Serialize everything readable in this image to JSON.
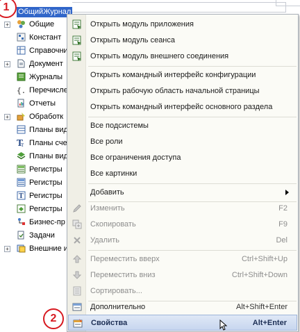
{
  "root": {
    "label": "ОбщийЖурнал"
  },
  "tree_items": [
    {
      "label": "Общие",
      "icon": "common-icon"
    },
    {
      "label": "Констант",
      "icon": "constant-icon"
    },
    {
      "label": "Справочни",
      "icon": "catalog-icon"
    },
    {
      "label": "Документ",
      "icon": "document-icon"
    },
    {
      "label": "Журналы",
      "icon": "journal-icon"
    },
    {
      "label": "Перечисле",
      "icon": "enum-icon"
    },
    {
      "label": "Отчеты",
      "icon": "report-icon"
    },
    {
      "label": "Обработк",
      "icon": "data-processor-icon"
    },
    {
      "label": "Планы вид",
      "icon": "chart-of-characteristics-icon"
    },
    {
      "label": "Планы сче",
      "icon": "chart-of-accounts-icon"
    },
    {
      "label": "Планы вид",
      "icon": "chart-of-calculation-icon"
    },
    {
      "label": "Регистры",
      "icon": "info-register-icon"
    },
    {
      "label": "Регистры",
      "icon": "accum-register-icon"
    },
    {
      "label": "Регистры",
      "icon": "accounting-register-icon"
    },
    {
      "label": "Регистры",
      "icon": "calculation-register-icon"
    },
    {
      "label": "Бизнес-пр",
      "icon": "business-process-icon"
    },
    {
      "label": "Задачи",
      "icon": "task-icon"
    },
    {
      "label": "Внешние и",
      "icon": "external-icon"
    }
  ],
  "badges": {
    "step1": "1",
    "step2": "2"
  },
  "menu": {
    "items": [
      {
        "label": "Открыть модуль приложения",
        "icon": "module-icon"
      },
      {
        "label": "Открыть модуль сеанса",
        "icon": "module-icon"
      },
      {
        "label": "Открыть модуль внешнего соединения",
        "icon": "module-icon"
      },
      {
        "label": "Открыть командный интерфейс конфигурации"
      },
      {
        "label": "Открыть рабочую область начальной страницы"
      },
      {
        "label": "Открыть командный интерфейс основного раздела"
      },
      {
        "label": "Все подсистемы"
      },
      {
        "label": "Все роли"
      },
      {
        "label": "Все ограничения доступа"
      },
      {
        "label": "Все картинки"
      },
      {
        "label": "Добавить"
      },
      {
        "label": "Изменить",
        "shortcut": "F2",
        "icon": "pencil-icon"
      },
      {
        "label": "Скопировать",
        "shortcut": "F9",
        "icon": "copy-icon"
      },
      {
        "label": "Удалить",
        "shortcut": "Del",
        "icon": "delete-icon"
      },
      {
        "label": "Переместить вверх",
        "shortcut": "Ctrl+Shift+Up",
        "icon": "arrow-up-icon"
      },
      {
        "label": "Переместить вниз",
        "shortcut": "Ctrl+Shift+Down",
        "icon": "arrow-down-icon"
      },
      {
        "label": "Сортировать...",
        "icon": "sort-icon"
      },
      {
        "label": "Дополнительно",
        "shortcut": "Alt+Shift+Enter",
        "icon": "extra-icon"
      },
      {
        "label": "Свойства",
        "shortcut": "Alt+Enter",
        "icon": "properties-icon"
      }
    ]
  },
  "colors": {
    "selection": "#3166c9",
    "badge": "#d71920",
    "highlight": "#c7d6ef"
  }
}
